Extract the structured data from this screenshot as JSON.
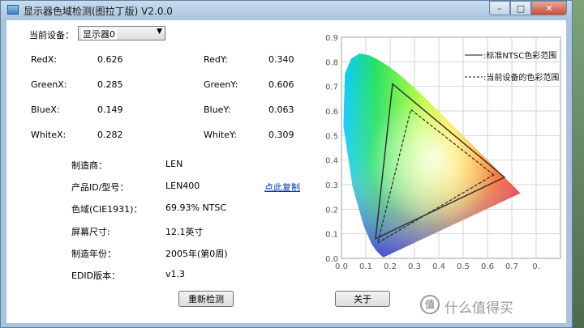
{
  "window": {
    "title": "显示器色域检测(图拉丁版) V2.0.0",
    "min_glyph": "–",
    "max_glyph": "□",
    "close_glyph": "✕"
  },
  "device": {
    "label": "当前设备：",
    "selected": "显示器0"
  },
  "color_values": {
    "redx": {
      "label": "RedX:",
      "value": "0.626"
    },
    "redy": {
      "label": "RedY:",
      "value": "0.340"
    },
    "greenx": {
      "label": "GreenX:",
      "value": "0.285"
    },
    "greeny": {
      "label": "GreenY:",
      "value": "0.606"
    },
    "bluex": {
      "label": "BlueX:",
      "value": "0.149"
    },
    "bluey": {
      "label": "BlueY:",
      "value": "0.063"
    },
    "whitex": {
      "label": "WhiteX:",
      "value": "0.282"
    },
    "whitey": {
      "label": "WhiteY:",
      "value": "0.309"
    }
  },
  "info": {
    "maker": {
      "label": "制造商：",
      "value": "LEN"
    },
    "product": {
      "label": "产品ID/型号：",
      "value": "LEN400"
    },
    "gamut": {
      "label": "色域(CIE1931)：",
      "value": "69.93% NTSC"
    },
    "size": {
      "label": "屏幕尺寸:",
      "value": "12.1英寸"
    },
    "year": {
      "label": "制造年份：",
      "value": "2005年(第0周)"
    },
    "edid": {
      "label": "EDID版本：",
      "value": "v1.3"
    }
  },
  "copy_link": "点此复制",
  "buttons": {
    "redetect": "重新检测",
    "about": "关于"
  },
  "chart_data": {
    "type": "scatter",
    "xlim": [
      0,
      0.9
    ],
    "ylim": [
      0,
      0.9
    ],
    "x_ticks": [
      "0.0",
      "0.1",
      "0.2",
      "0.3",
      "0.4",
      "0.5",
      "0.6",
      "0.7",
      "0."
    ],
    "y_ticks": [
      "0.0",
      "0.1",
      "0.2",
      "0.3",
      "0.4",
      "0.5",
      "0.6",
      "0.7",
      "0.8",
      "0.9"
    ],
    "grid": true,
    "legend_position": "top-right",
    "legend": [
      {
        "style": "solid",
        "label": "标准NTSC色彩范围"
      },
      {
        "style": "dashed",
        "label": "当前设备的色彩范围"
      }
    ],
    "ntsc_triangle": [
      [
        0.67,
        0.33
      ],
      [
        0.21,
        0.71
      ],
      [
        0.14,
        0.08
      ]
    ],
    "device_triangle": [
      [
        0.626,
        0.34
      ],
      [
        0.285,
        0.606
      ],
      [
        0.149,
        0.063
      ]
    ],
    "spectral_locus": [
      [
        0.174,
        0.005
      ],
      [
        0.173,
        0.005
      ],
      [
        0.171,
        0.005
      ],
      [
        0.166,
        0.009
      ],
      [
        0.156,
        0.018
      ],
      [
        0.144,
        0.03
      ],
      [
        0.124,
        0.058
      ],
      [
        0.091,
        0.133
      ],
      [
        0.045,
        0.295
      ],
      [
        0.008,
        0.538
      ],
      [
        0.014,
        0.75
      ],
      [
        0.039,
        0.812
      ],
      [
        0.074,
        0.834
      ],
      [
        0.115,
        0.826
      ],
      [
        0.155,
        0.806
      ],
      [
        0.193,
        0.782
      ],
      [
        0.23,
        0.754
      ],
      [
        0.266,
        0.724
      ],
      [
        0.302,
        0.692
      ],
      [
        0.337,
        0.659
      ],
      [
        0.373,
        0.624
      ],
      [
        0.408,
        0.59
      ],
      [
        0.444,
        0.555
      ],
      [
        0.479,
        0.52
      ],
      [
        0.512,
        0.487
      ],
      [
        0.545,
        0.454
      ],
      [
        0.575,
        0.424
      ],
      [
        0.603,
        0.397
      ],
      [
        0.627,
        0.373
      ],
      [
        0.648,
        0.351
      ],
      [
        0.666,
        0.334
      ],
      [
        0.68,
        0.32
      ],
      [
        0.691,
        0.309
      ],
      [
        0.701,
        0.299
      ],
      [
        0.713,
        0.287
      ],
      [
        0.735,
        0.265
      ]
    ]
  },
  "watermark": {
    "icon": "值",
    "text": "什么值得买"
  }
}
